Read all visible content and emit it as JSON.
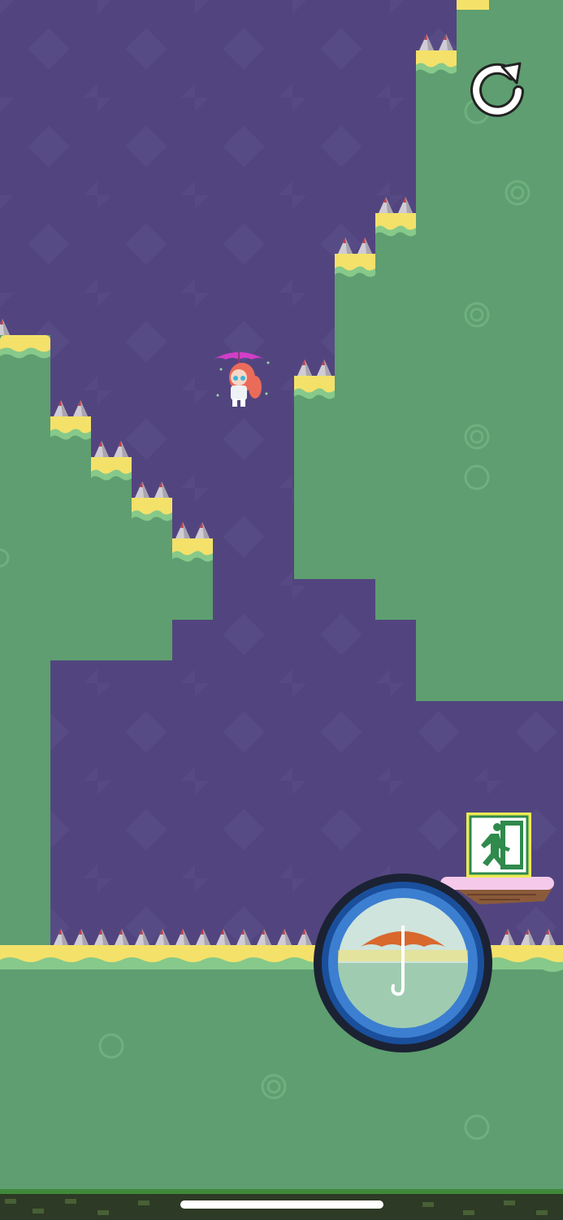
{
  "game": {
    "colors": {
      "sky": "#52457f",
      "sky_diamond": "#5b4e8b",
      "ground": "#5e9e70",
      "ground_ring": "#6fb07f",
      "grass_top": "#f4e16a",
      "grass_wave": "#86c98a",
      "spike": "#c9c6cf",
      "spike_tip": "#c23a45",
      "umbrella_ring_outer": "#1a4f9c",
      "umbrella_ring_inner": "#3c7fd1",
      "umbrella_canopy": "#d8682c",
      "exit_sign": "#2f8a4c",
      "exit_frame": "#ecea56",
      "cloud_platform": "#f4c9ea",
      "brick": "#2d3a25"
    },
    "controls": {
      "restart_icon": "restart-icon",
      "umbrella_icon": "umbrella-icon"
    },
    "level_objects": {
      "exit_icon": "exit-sign-icon",
      "character_icon": "umbrella-girl-icon",
      "hazard_icon": "spike-icon"
    }
  }
}
